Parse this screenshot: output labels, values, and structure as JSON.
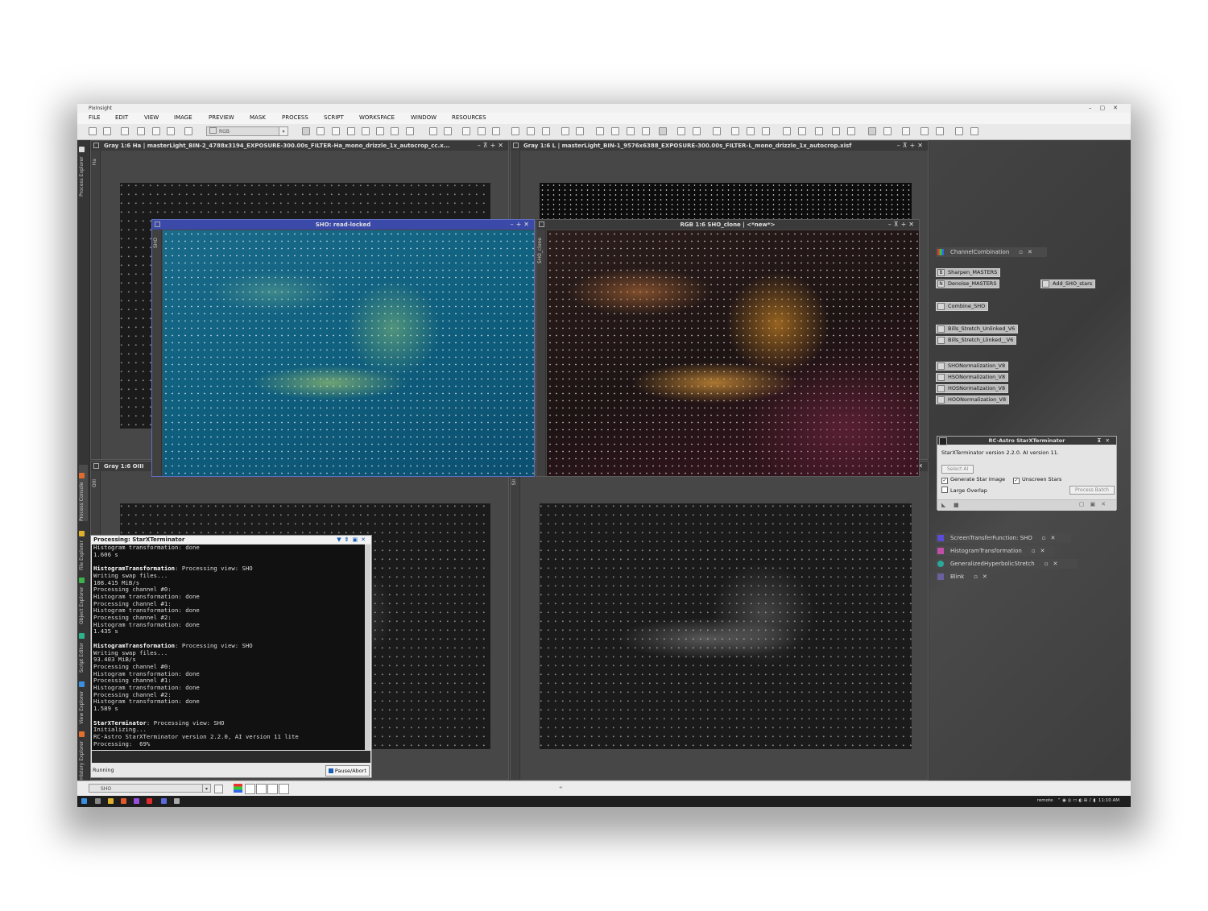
{
  "app": {
    "title": "PixInsight"
  },
  "menu": [
    "FILE",
    "EDIT",
    "VIEW",
    "IMAGE",
    "PREVIEW",
    "MASK",
    "PROCESS",
    "SCRIPT",
    "WORKSPACE",
    "WINDOW",
    "RESOURCES"
  ],
  "toolbar": {
    "view_selector": "RGB"
  },
  "left_tabs": [
    "Process Explorer",
    "Process Console",
    "File Explorer",
    "Object Explorer",
    "Script Editor",
    "View Explorer",
    "History Explorer"
  ],
  "windows": {
    "ha": {
      "title": "Gray 1:6 Ha | masterLight_BIN-2_4788x3194_EXPOSURE-300.00s_FILTER-Ha_mono_drizzle_1x_autocrop_cc.x...",
      "side": "Ha"
    },
    "l": {
      "title": "Gray 1:6 L | masterLight_BIN-1_9576x6388_EXPOSURE-300.00s_FILTER-L_mono_drizzle_1x_autocrop.xisf"
    },
    "oiii": {
      "title": "Gray 1:6 OIII",
      "side": "OIII"
    },
    "sii": {
      "side": "SII"
    },
    "sho": {
      "title": "SHO: read-locked",
      "side": "SHO"
    },
    "rgb": {
      "title": "RGB 1:6 SHO_clone | <*new*>",
      "side": "SHO_clone"
    }
  },
  "console": {
    "title": "Processing: StarXTerminator",
    "lines": [
      {
        "t": "Histogram transformation: done",
        "b": false
      },
      {
        "t": "1.606 s",
        "b": false
      },
      {
        "t": "",
        "b": false
      },
      {
        "t": "HistogramTransformation",
        "r": ": Processing view: SHO",
        "b": true
      },
      {
        "t": "Writing swap files...",
        "b": false
      },
      {
        "t": "108.415 MiB/s",
        "b": false
      },
      {
        "t": "Processing channel #0:",
        "b": false
      },
      {
        "t": "Histogram transformation: done",
        "b": false
      },
      {
        "t": "Processing channel #1:",
        "b": false
      },
      {
        "t": "Histogram transformation: done",
        "b": false
      },
      {
        "t": "Processing channel #2:",
        "b": false
      },
      {
        "t": "Histogram transformation: done",
        "b": false
      },
      {
        "t": "1.435 s",
        "b": false
      },
      {
        "t": "",
        "b": false
      },
      {
        "t": "HistogramTransformation",
        "r": ": Processing view: SHO",
        "b": true
      },
      {
        "t": "Writing swap files...",
        "b": false
      },
      {
        "t": "93.403 MiB/s",
        "b": false
      },
      {
        "t": "Processing channel #0:",
        "b": false
      },
      {
        "t": "Histogram transformation: done",
        "b": false
      },
      {
        "t": "Processing channel #1:",
        "b": false
      },
      {
        "t": "Histogram transformation: done",
        "b": false
      },
      {
        "t": "Processing channel #2:",
        "b": false
      },
      {
        "t": "Histogram transformation: done",
        "b": false
      },
      {
        "t": "1.589 s",
        "b": false
      },
      {
        "t": "",
        "b": false
      },
      {
        "t": "StarXTerminator",
        "r": ": Processing view: SHO",
        "b": true
      },
      {
        "t": "Initializing...",
        "b": false
      },
      {
        "t": "RC-Astro StarXTerminator version 2.2.0, AI version 11 lite",
        "b": false
      },
      {
        "t": "Processing:  69%",
        "b": false
      }
    ],
    "status": "Running",
    "pause_label": "Pause/Abort"
  },
  "process_icons": {
    "channel_combination": "ChannelCombination",
    "sharpen": {
      "letter": "B",
      "label": "Sharpen_MASTERS"
    },
    "denoise": {
      "letter": "N",
      "label": "Denoise_MASTERS"
    },
    "add_sho_stars": "Add_SHO_stars",
    "combine_sho": "Combine_SHO",
    "bills_unlinked": "Bills_Stretch_Unlinked_V6",
    "bills_linked": "Bills_Stretch_Llinked__V6",
    "sho_norm": "SHONormalization_V8",
    "hso_norm": "HSONormalization_V8",
    "hos_norm": "HOSNormalization_V8",
    "hoo_norm": "HOONormalization_V8"
  },
  "starx": {
    "title": "RC-Astro StarXTerminator",
    "version": "StarXTerminator version 2.2.0. AI version 11.",
    "select_ai": "Select AI",
    "generate_star_image": "Generate Star Image",
    "unscreen_stars": "Unscreen Stars",
    "large_overlap": "Large Overlap",
    "process_batch": "Process Batch"
  },
  "process_windows": [
    "ScreenTransferFunction: SHO",
    "HistogramTransformation",
    "GeneralizedHyperbolicStretch",
    "Blink"
  ],
  "bottom": {
    "view": "SHO"
  },
  "taskbar": {
    "remote": "remote",
    "time": "11:10 AM"
  },
  "colors": {
    "accent": "#1b5fb4",
    "sho_header": "#3b4aa8"
  }
}
